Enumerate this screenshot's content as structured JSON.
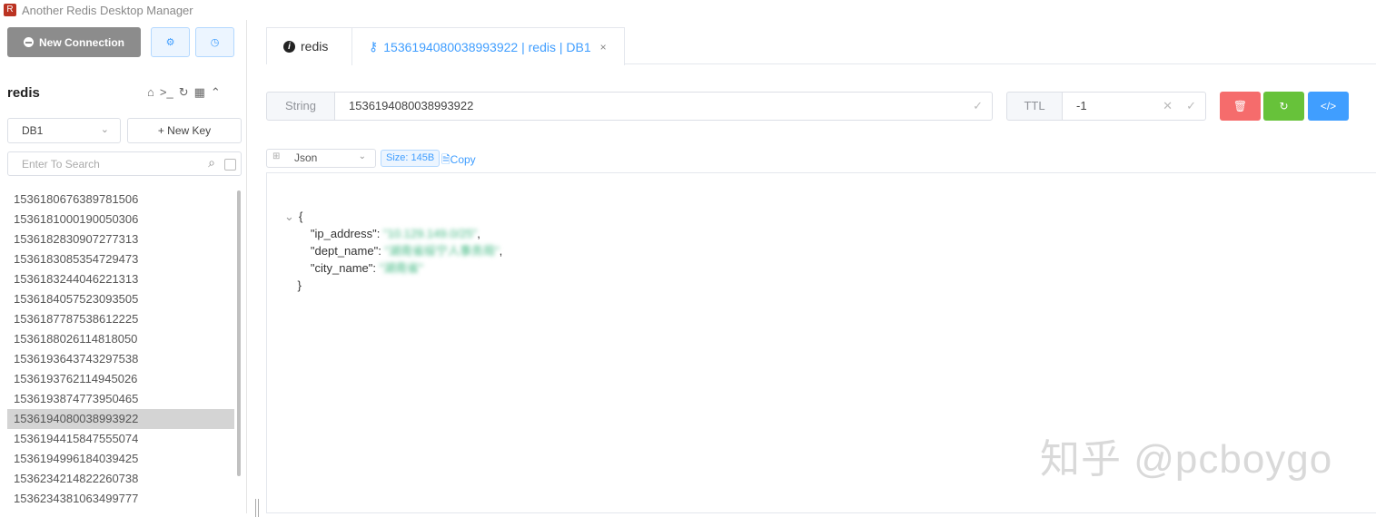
{
  "window": {
    "title": "Another Redis Desktop Manager"
  },
  "sidebar": {
    "new_connection_label": "New Connection",
    "connection_name": "redis",
    "db_selected": "DB1",
    "new_key_label": "+ New Key",
    "search_placeholder": "Enter To Search",
    "keys": [
      "1536180676389781506",
      "1536181000190050306",
      "1536182830907277313",
      "1536183085354729473",
      "1536183244046221313",
      "1536184057523093505",
      "1536187787538612225",
      "1536188026114818050",
      "1536193643743297538",
      "1536193762114945026",
      "1536193874773950465",
      "1536194080038993922",
      "1536194415847555074",
      "1536194996184039425",
      "1536234214822260738",
      "1536234381063499777"
    ],
    "active_key_index": 11
  },
  "tabs": [
    {
      "label": "redis",
      "icon": "info-icon"
    },
    {
      "label": "1536194080038993922 | redis | DB1",
      "icon": "key-icon"
    }
  ],
  "detail": {
    "type_label": "String",
    "key_value": "1536194080038993922",
    "ttl_label": "TTL",
    "ttl_value": "-1",
    "format": "Json",
    "size": "Size: 145B",
    "copy_label": "Copy"
  },
  "json_view": {
    "open_brace": "{",
    "close_brace": "}",
    "fields": [
      {
        "key": "\"ip_address\"",
        "value": "\"10.129.149.0/25\"",
        "blurred": true
      },
      {
        "key": "\"dept_name\"",
        "value": "\"湖南省绥宁人事务局\"",
        "blurred": true
      },
      {
        "key": "\"city_name\"",
        "value": "\"湖南省\"",
        "blurred": true
      }
    ]
  },
  "watermark": "知乎 @pcboygo",
  "colors": {
    "primary": "#409eff",
    "danger": "#f56c6c",
    "success": "#67c23a",
    "string": "#42b983"
  }
}
